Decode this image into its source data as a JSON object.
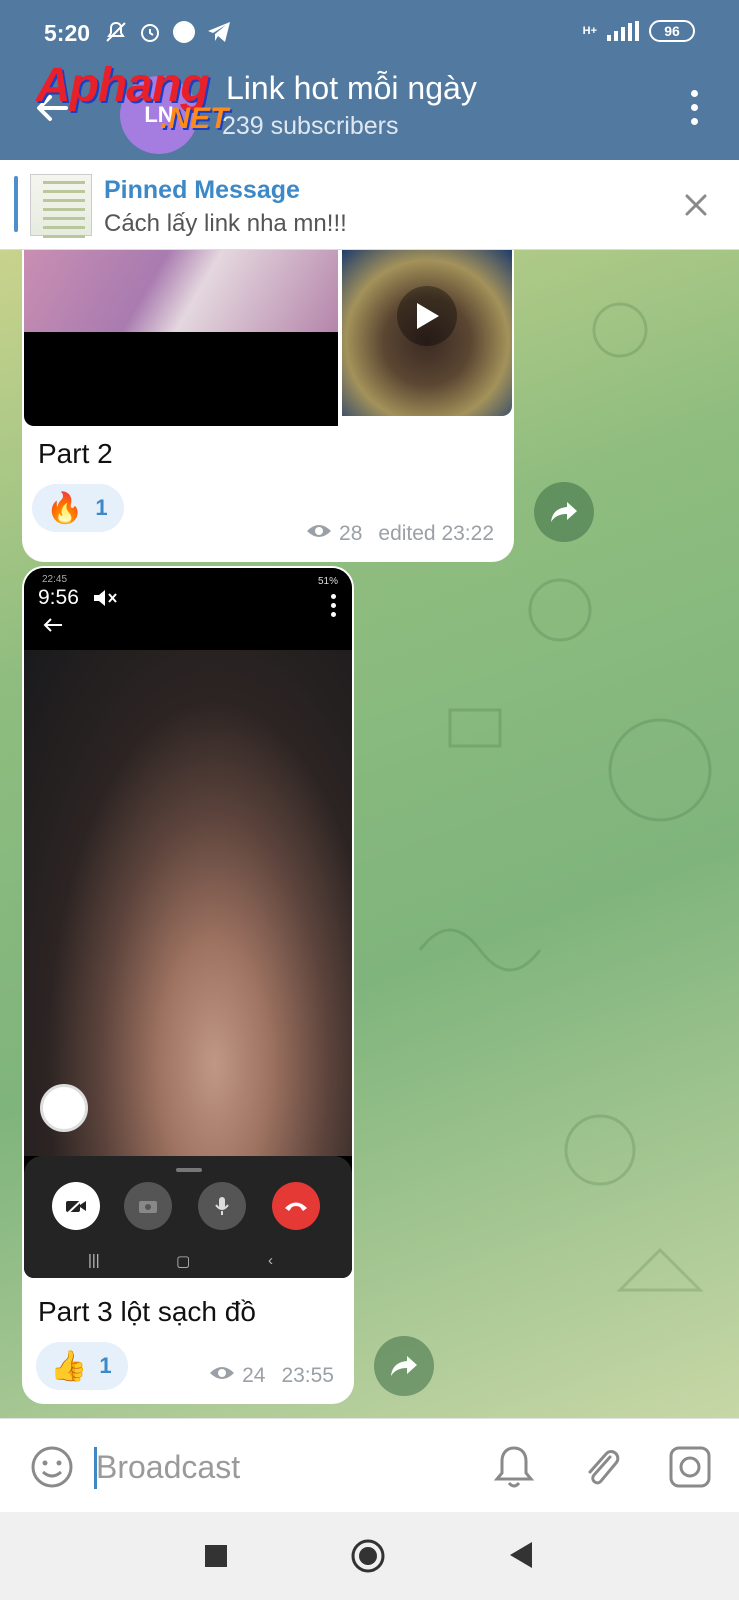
{
  "status_bar": {
    "time": "5:20",
    "network_label": "H+",
    "battery": "96"
  },
  "header": {
    "watermark_line1": "Aphang",
    "watermark_line2": ".NET",
    "avatar_text": "LN",
    "title": "Link hot mỗi ngày",
    "subtitle": "239 subscribers"
  },
  "pinned": {
    "title": "Pinned Message",
    "text": "Cách lấy link nha mn!!!"
  },
  "messages": [
    {
      "caption": "Part 2",
      "reaction_emoji": "🔥",
      "reaction_count": "1",
      "views": "28",
      "time": "edited 23:22"
    },
    {
      "caption": "Part 3 lột sạch đồ",
      "reaction_emoji": "👍",
      "reaction_count": "1",
      "views": "24",
      "time": "23:55",
      "embedded_phone": {
        "time": "9:56",
        "small_time": "22:45",
        "battery": "51%"
      }
    }
  ],
  "input": {
    "placeholder": "Broadcast"
  },
  "colors": {
    "header": "#52799f",
    "accent": "#3d89c8",
    "end_call": "#e53935"
  }
}
